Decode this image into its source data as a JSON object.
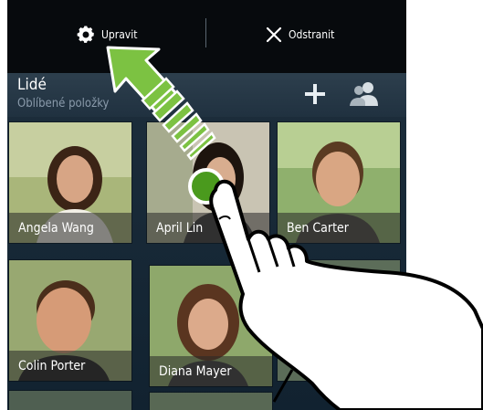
{
  "toolbar": {
    "edit_label": "Upravit",
    "remove_label": "Odstranit"
  },
  "widget": {
    "title": "Lidé",
    "subtitle": "Oblíbené položky",
    "add_icon": "plus-icon",
    "people_icon": "people-icon"
  },
  "contacts": [
    {
      "name": "Angela Wang"
    },
    {
      "name": "April Lin"
    },
    {
      "name": "Ben Carter"
    },
    {
      "name": "Colin Porter"
    },
    {
      "name": "Diana Mayer"
    },
    {
      "name": ""
    }
  ],
  "gesture": {
    "type": "drag-up",
    "arrow_color": "#7cc242",
    "touch_point_color": "#4a9a1d"
  }
}
